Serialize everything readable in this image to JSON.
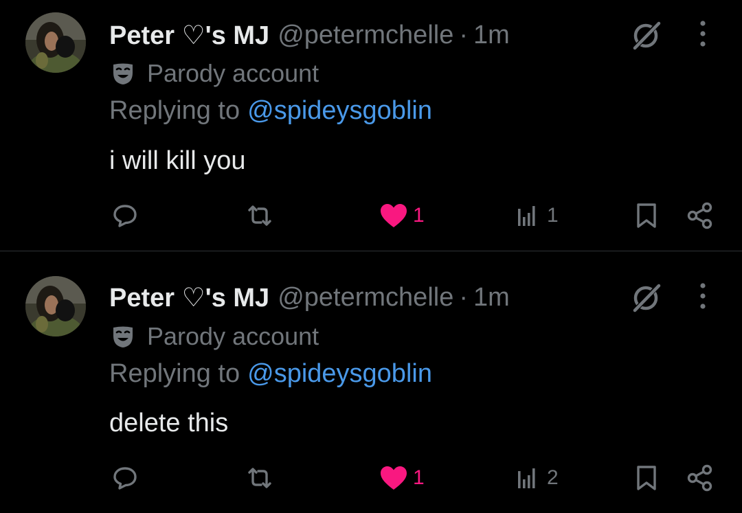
{
  "tweets": [
    {
      "display_name": "Peter ♡'s MJ",
      "handle": "@petermchelle",
      "separator": "·",
      "time": "1m",
      "badge_label": "Parody account",
      "replying_prefix": "Replying to",
      "replying_handle": "@spideysgoblin",
      "text": "i will kill you",
      "likes": "1",
      "views": "1",
      "liked": true
    },
    {
      "display_name": "Peter ♡'s MJ",
      "handle": "@petermchelle",
      "separator": "·",
      "time": "1m",
      "badge_label": "Parody account",
      "replying_prefix": "Replying to",
      "replying_handle": "@spideysgoblin",
      "text": "delete this",
      "likes": "1",
      "views": "2",
      "liked": true
    }
  ],
  "colors": {
    "background": "#000000",
    "text_primary": "#e7e9ea",
    "text_secondary": "#71767b",
    "link": "#4a99e9",
    "like": "#f91880",
    "divider": "#2f3336"
  },
  "icons": {
    "reply": "reply-bubble-icon",
    "repost": "repost-icon",
    "like": "heart-filled-icon",
    "views": "views-bars-icon",
    "bookmark": "bookmark-icon",
    "share": "share-icon",
    "grok": "grok-icon",
    "more": "more-vertical-icon",
    "parody": "theater-mask-icon"
  }
}
